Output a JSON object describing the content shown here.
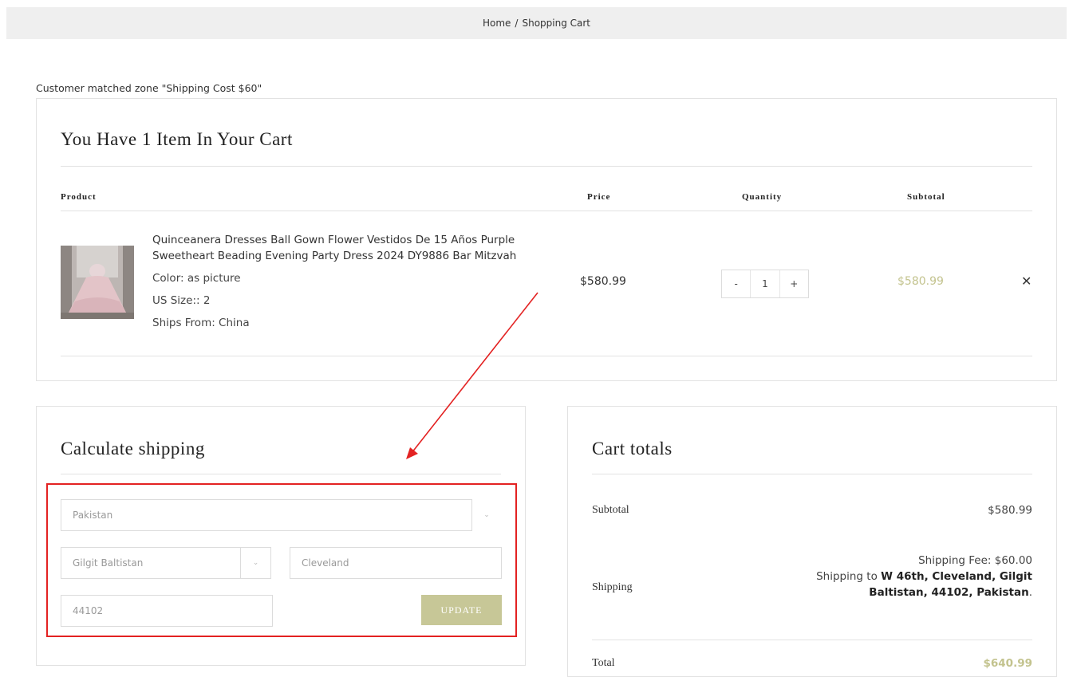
{
  "breadcrumb": {
    "home": "Home",
    "separator": "/",
    "current": "Shopping Cart"
  },
  "zone_note": "Customer matched zone \"Shipping Cost $60\"",
  "cart": {
    "heading": "You Have 1 Item In Your Cart",
    "columns": {
      "product": "Product",
      "price": "Price",
      "quantity": "Quantity",
      "subtotal": "Subtotal"
    },
    "item": {
      "name": "Quinceanera Dresses Ball Gown Flower Vestidos De 15 Años Purple Sweetheart Beading Evening Party Dress 2024 DY9886 Bar Mitzvah",
      "color": "Color: as picture",
      "size": "US Size:: 2",
      "ships_from": "Ships From: China",
      "price": "$580.99",
      "qty_minus": "-",
      "quantity": "1",
      "qty_plus": "+",
      "subtotal": "$580.99",
      "remove": "✕"
    }
  },
  "shipping_calc": {
    "title": "Calculate shipping",
    "country": "Pakistan",
    "state": "Gilgit Baltistan",
    "city": "Cleveland",
    "postcode": "44102",
    "update_label": "UPDATE"
  },
  "totals": {
    "title": "Cart totals",
    "subtotal_label": "Subtotal",
    "subtotal_value": "$580.99",
    "shipping_label": "Shipping",
    "shipping_fee": "Shipping Fee: $60.00",
    "shipping_to_prefix": "Shipping to",
    "shipping_to_address": "W 46th, Cleveland, Gilgit Baltistan, 44102, Pakistan",
    "shipping_to_suffix": ".",
    "total_label": "Total",
    "total_value": "$640.99"
  },
  "colors": {
    "accent": "#c7c797",
    "annotation": "#e32222",
    "breadcrumb_bg": "#efefef"
  },
  "icons": {
    "dropdown": "chevron-down-icon",
    "remove": "close-icon",
    "annotation": "arrow-annotation"
  }
}
